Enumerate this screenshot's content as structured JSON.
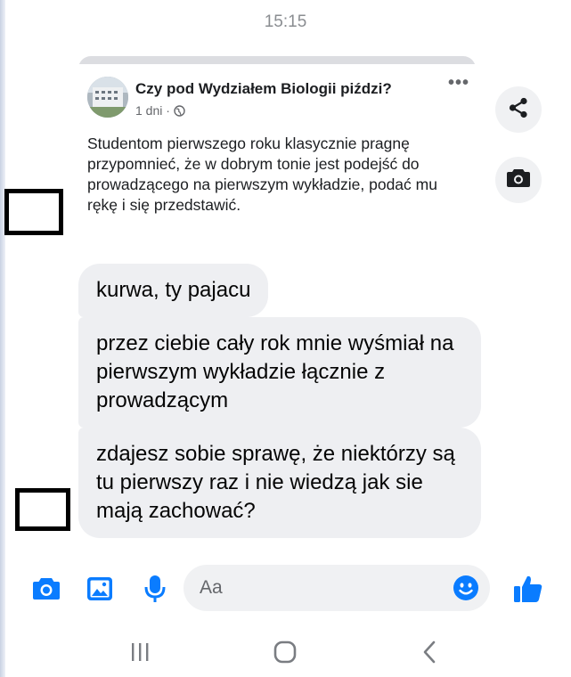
{
  "status": {
    "time": "15:15"
  },
  "post": {
    "group_name": "Czy pod Wydziałem Biologii piździ?",
    "age": "1 dni ·",
    "body": "Studentom pierwszego roku klasycznie pragnę przypomnieć, że w dobrym tonie jest podejść do prowadzącego na pierwszym wykładzie, podać mu rękę i się przedstawić."
  },
  "side_actions": {
    "share_icon": "share-icon",
    "camera_icon": "camera-icon"
  },
  "messages": [
    {
      "text": "kurwa, ty pajacu"
    },
    {
      "text": "przez ciebie cały rok mnie wyśmiał na pierwszym wykładzie łącznie z prowadzącym"
    },
    {
      "text": "zdajesz sobie sprawę, że niektórzy są tu pierwszy raz i nie wiedzą jak sie mają zachować?"
    }
  ],
  "composer": {
    "placeholder": "Aa"
  },
  "colors": {
    "accent": "#0a7cff",
    "bubble": "#eeeff2",
    "meta": "#65676b"
  }
}
